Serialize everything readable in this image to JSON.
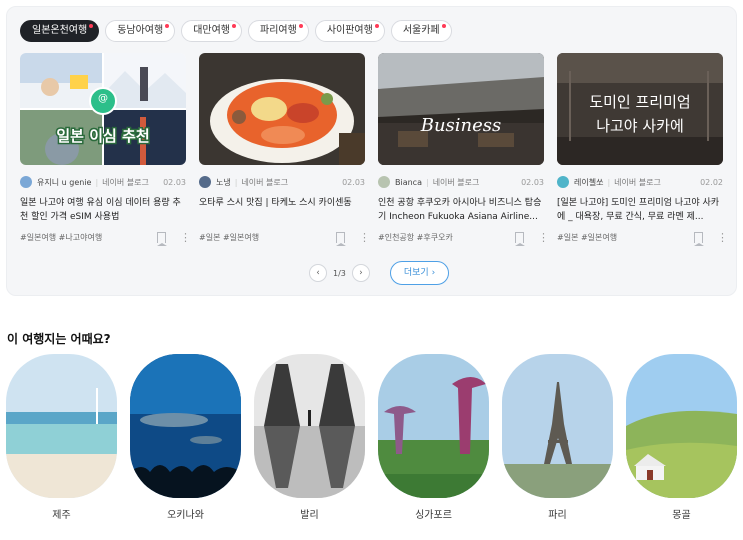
{
  "tabs": [
    {
      "label": "일본온천여행",
      "active": true
    },
    {
      "label": "동남아여행"
    },
    {
      "label": "대만여행"
    },
    {
      "label": "파리여행"
    },
    {
      "label": "사이판여행"
    },
    {
      "label": "서울카페"
    }
  ],
  "cards": [
    {
      "author": "유지니 u genie",
      "source": "네이버 블로그",
      "date": "02.03",
      "title": "일본 나고야 여행 유심 이심 데이터 용량 추천 할인 가격 eSIM 사용법",
      "tags": "#일본여행 #나고야여행",
      "thumb_text": "일본 이심 추천",
      "thumb_badge": "@"
    },
    {
      "author": "노냉",
      "source": "네이버 블로그",
      "date": "02.03",
      "title": "오타루 스시 맛집 | 타케노 스시 카이센동",
      "tags": "#일본 #일본여행"
    },
    {
      "author": "Bianca",
      "source": "네이버 블로그",
      "date": "02.03",
      "title": "인천 공항 후쿠오카 아시아나 비즈니스 탑승기 Incheon Fukuoka Asiana Airline...",
      "tags": "#인천공항 #후쿠오카",
      "thumb_text": "Business"
    },
    {
      "author": "레이첼쏘",
      "source": "네이버 블로그",
      "date": "02.02",
      "title": "[일본 나고야] 도미인 프리미엄 나고야 사카에 _ 대욕장, 무료 간식, 무료 라멘 제...",
      "tags": "#일본 #일본여행",
      "thumb_text_1": "도미인 프리미엄",
      "thumb_text_2": "나고야 사카에"
    }
  ],
  "pager": {
    "prev": "‹",
    "page": "1/3",
    "next": "›",
    "more": "더보기 ›"
  },
  "section_title": "이 여행지는 어때요?",
  "destinations": [
    {
      "name": "제주"
    },
    {
      "name": "오키나와"
    },
    {
      "name": "발리"
    },
    {
      "name": "싱가포르"
    },
    {
      "name": "파리"
    },
    {
      "name": "몽골"
    }
  ],
  "colors": {
    "accent": "#3a8fd8",
    "tab_active": "#1f2227",
    "dot": "#ff3b57"
  }
}
